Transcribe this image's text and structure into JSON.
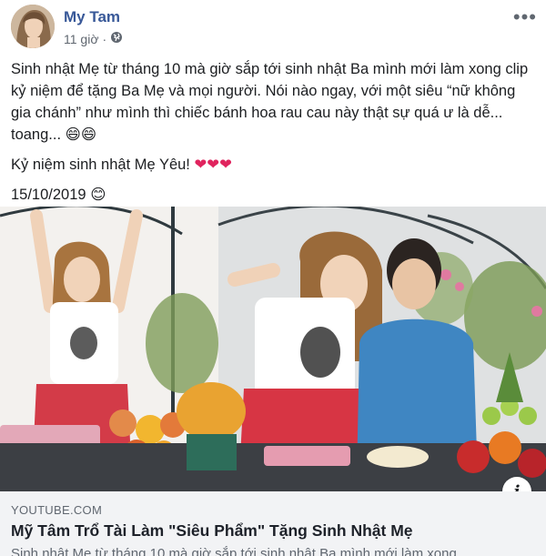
{
  "post": {
    "author": "My Tam",
    "time": "11 giờ",
    "separator": "·",
    "more_label": "•••",
    "text": {
      "line1": "Sinh nhật Mẹ từ tháng 10 mà giờ sắp tới sinh nhật Ba mình mới làm xong clip kỷ niệm để tặng Ba Mẹ và mọi người. Nói nào ngay, với một siêu “nữ không gia chánh” như mình thì chiếc bánh hoa rau cau này thật sự quá ư là dễ... toang...",
      "line1_emoji": "😄😄",
      "line2": "Kỷ niệm sinh nhật Mẹ Yêu!",
      "line2_emoji": "❤❤❤",
      "line3": "15/10/2019",
      "line3_emoji": "😊"
    }
  },
  "link_preview": {
    "domain": "YOUTUBE.COM",
    "title": "Mỹ Tâm Trổ Tài Làm \"Siêu Phẩm\" Tặng Sinh Nhật Mẹ",
    "description": "Sinh nhật Mẹ từ tháng 10 mà giờ sắp tới sinh nhật Ba mình mới làm xong",
    "info_label": "i"
  },
  "icons": [
    "globe-icon",
    "more-icon",
    "info-icon",
    "play-video-thumbnail"
  ],
  "colors": {
    "author": "#385898",
    "link_bg": "#f2f3f5",
    "heart": "#e0245e"
  }
}
